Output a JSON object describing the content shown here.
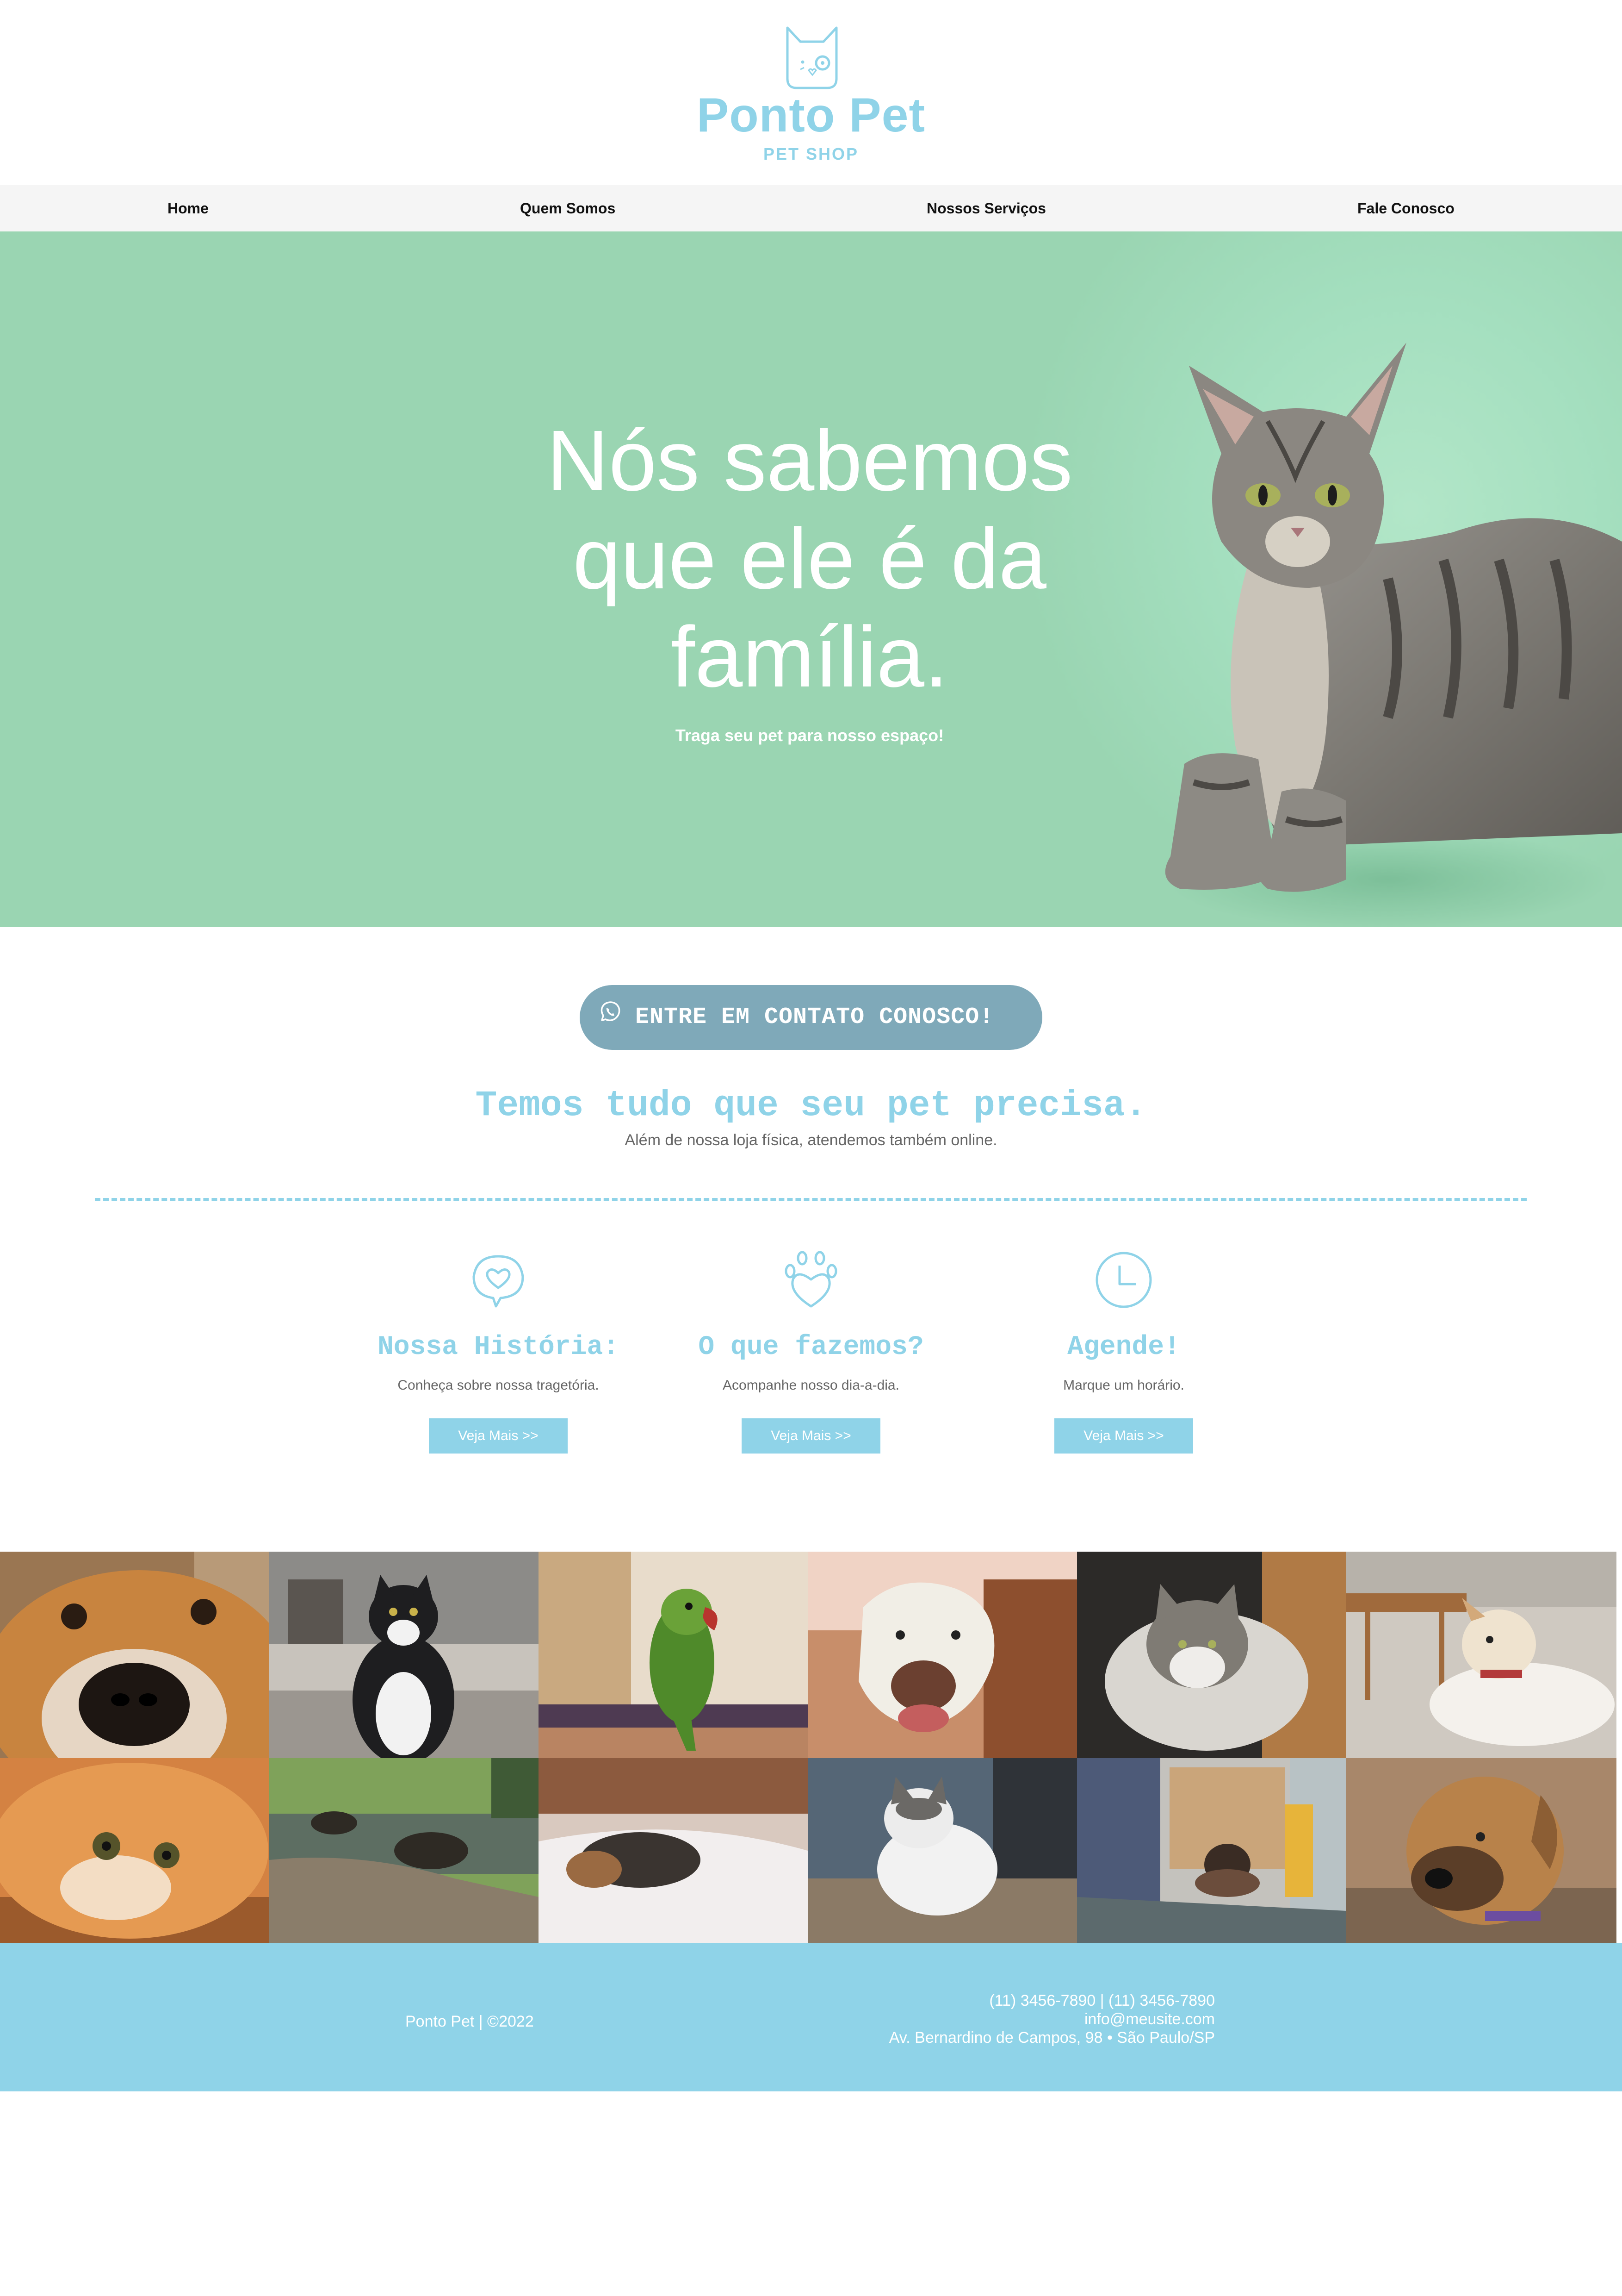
{
  "brand": {
    "name": "Ponto Pet",
    "tagline": "PET SHOP",
    "color": "#8fd3e8"
  },
  "nav": {
    "items": [
      {
        "label": "Home"
      },
      {
        "label": "Quem Somos"
      },
      {
        "label": "Nossos Serviços"
      },
      {
        "label": "Fale Conosco"
      }
    ]
  },
  "hero": {
    "title": "Nós sabemos\n que ele é da\nfamília.",
    "subtitle": "Traga seu pet para nosso espaço!",
    "background_color": "#9ad5b2",
    "image": "cat-photo"
  },
  "cta": {
    "icon": "whatsapp-icon",
    "label": "ENTRE EM CONTATO CONOSCO!",
    "color": "#7fa9b9"
  },
  "intro": {
    "title": "Temos tudo que seu pet precisa.",
    "subtitle": "Além de nossa loja física, atendemos também online."
  },
  "features": [
    {
      "icon": "heart-chat-icon",
      "title": "Nossa História:",
      "description": "Conheça sobre nossa tragetória.",
      "button": "Veja Mais >>"
    },
    {
      "icon": "paw-heart-icon",
      "title": "O que fazemos?",
      "description": "Acompanhe nosso dia-a-dia.",
      "button": "Veja Mais >>"
    },
    {
      "icon": "clock-icon",
      "title": "Agende!",
      "description": "Marque um horário.",
      "button": "Veja Mais >>"
    }
  ],
  "gallery": [
    {
      "subject": "beagle-closeup"
    },
    {
      "subject": "black-white-cat"
    },
    {
      "subject": "green-parrot"
    },
    {
      "subject": "white-dog-smiling"
    },
    {
      "subject": "tabby-cat-lying"
    },
    {
      "subject": "white-dog-collar"
    },
    {
      "subject": "orange-kitten"
    },
    {
      "subject": "turtle-on-rock"
    },
    {
      "subject": "dog-sleeping-bed"
    },
    {
      "subject": "white-cat-sitting"
    },
    {
      "subject": "hamster-house"
    },
    {
      "subject": "brown-dog-portrait"
    }
  ],
  "footer": {
    "copyright": "Ponto Pet | ©2022",
    "phones": "(11) 3456-7890 | (11) 3456-7890",
    "email": "info@meusite.com",
    "address": "Av. Bernardino de Campos, 98 • São Paulo/SP"
  }
}
